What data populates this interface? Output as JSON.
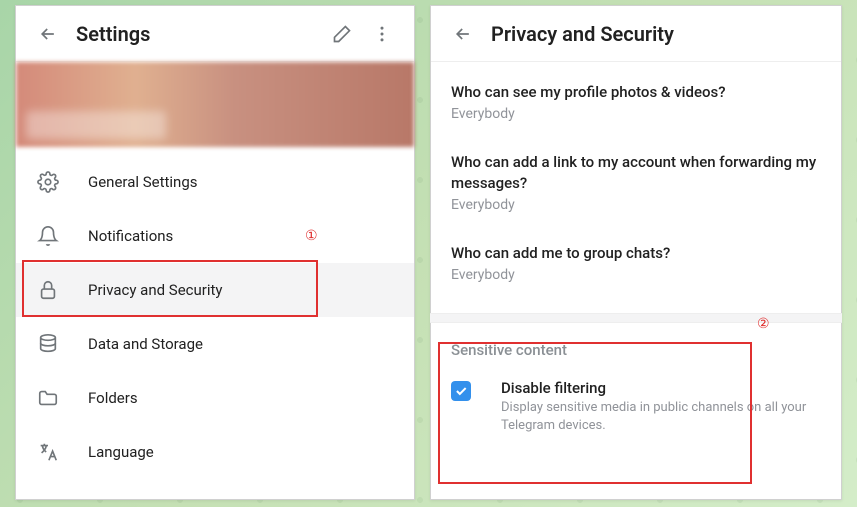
{
  "settings": {
    "title": "Settings",
    "menu": [
      {
        "icon": "gear-icon",
        "label": "General Settings"
      },
      {
        "icon": "bell-icon",
        "label": "Notifications"
      },
      {
        "icon": "lock-icon",
        "label": "Privacy and Security",
        "selected": true
      },
      {
        "icon": "disk-icon",
        "label": "Data and Storage"
      },
      {
        "icon": "folder-icon",
        "label": "Folders"
      },
      {
        "icon": "language-icon",
        "label": "Language"
      }
    ]
  },
  "privacy": {
    "title": "Privacy and Security",
    "items": [
      {
        "question": "Who can see my profile photos & videos?",
        "value": "Everybody"
      },
      {
        "question": "Who can add a link to my account when forwarding my messages?",
        "value": "Everybody"
      },
      {
        "question": "Who can add me to group chats?",
        "value": "Everybody"
      }
    ],
    "sensitive": {
      "header": "Sensitive content",
      "checkbox_label": "Disable filtering",
      "checkbox_desc": "Display sensitive media in public channels on all your Telegram devices.",
      "checked": true
    }
  },
  "annotations": {
    "one": "①",
    "two": "②"
  }
}
